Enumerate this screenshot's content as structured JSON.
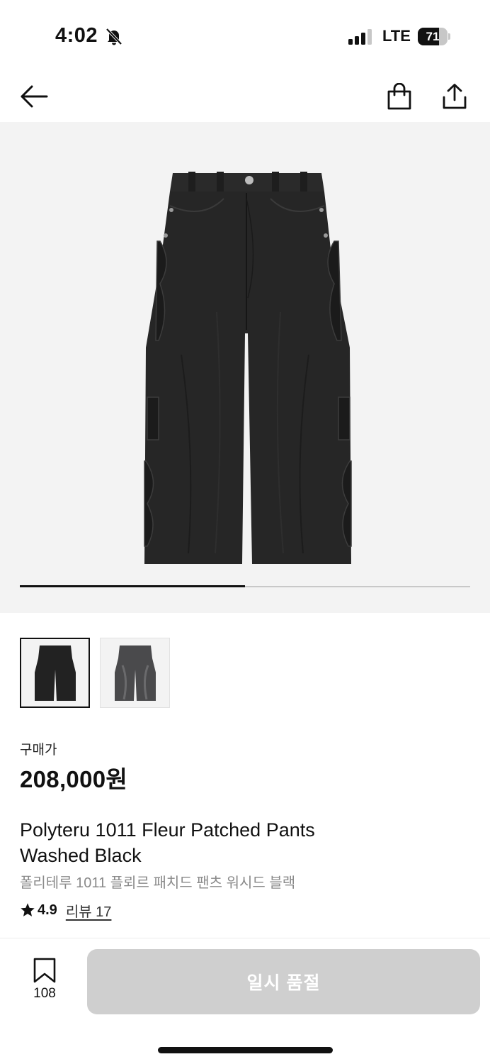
{
  "status_bar": {
    "time": "4:02",
    "network": "LTE",
    "battery": "71",
    "battery_level": 0.71
  },
  "nav": {
    "icons": [
      "back-arrow-icon",
      "shopping-bag-icon",
      "share-icon"
    ]
  },
  "gallery": {
    "current_slide": 1,
    "total_slides": 2,
    "progress": 0.5,
    "thumbnails": [
      "pants-black",
      "pants-washed-black"
    ]
  },
  "product": {
    "price_label": "구매가",
    "price": "208,000원",
    "title": "Polyteru 1011 Fleur Patched Pants Washed Black",
    "subtitle": "폴리테루 1011 플뢰르 패치드 팬츠 워시드 블랙",
    "rating": "4.9",
    "review_link": "리뷰 17"
  },
  "bottom_bar": {
    "bookmark_count": "108",
    "buy_button": "일시 품절"
  },
  "colors": {
    "accent": "#111111",
    "disabled_button": "#cfcfcf",
    "hero_background": "#f3f3f3"
  }
}
